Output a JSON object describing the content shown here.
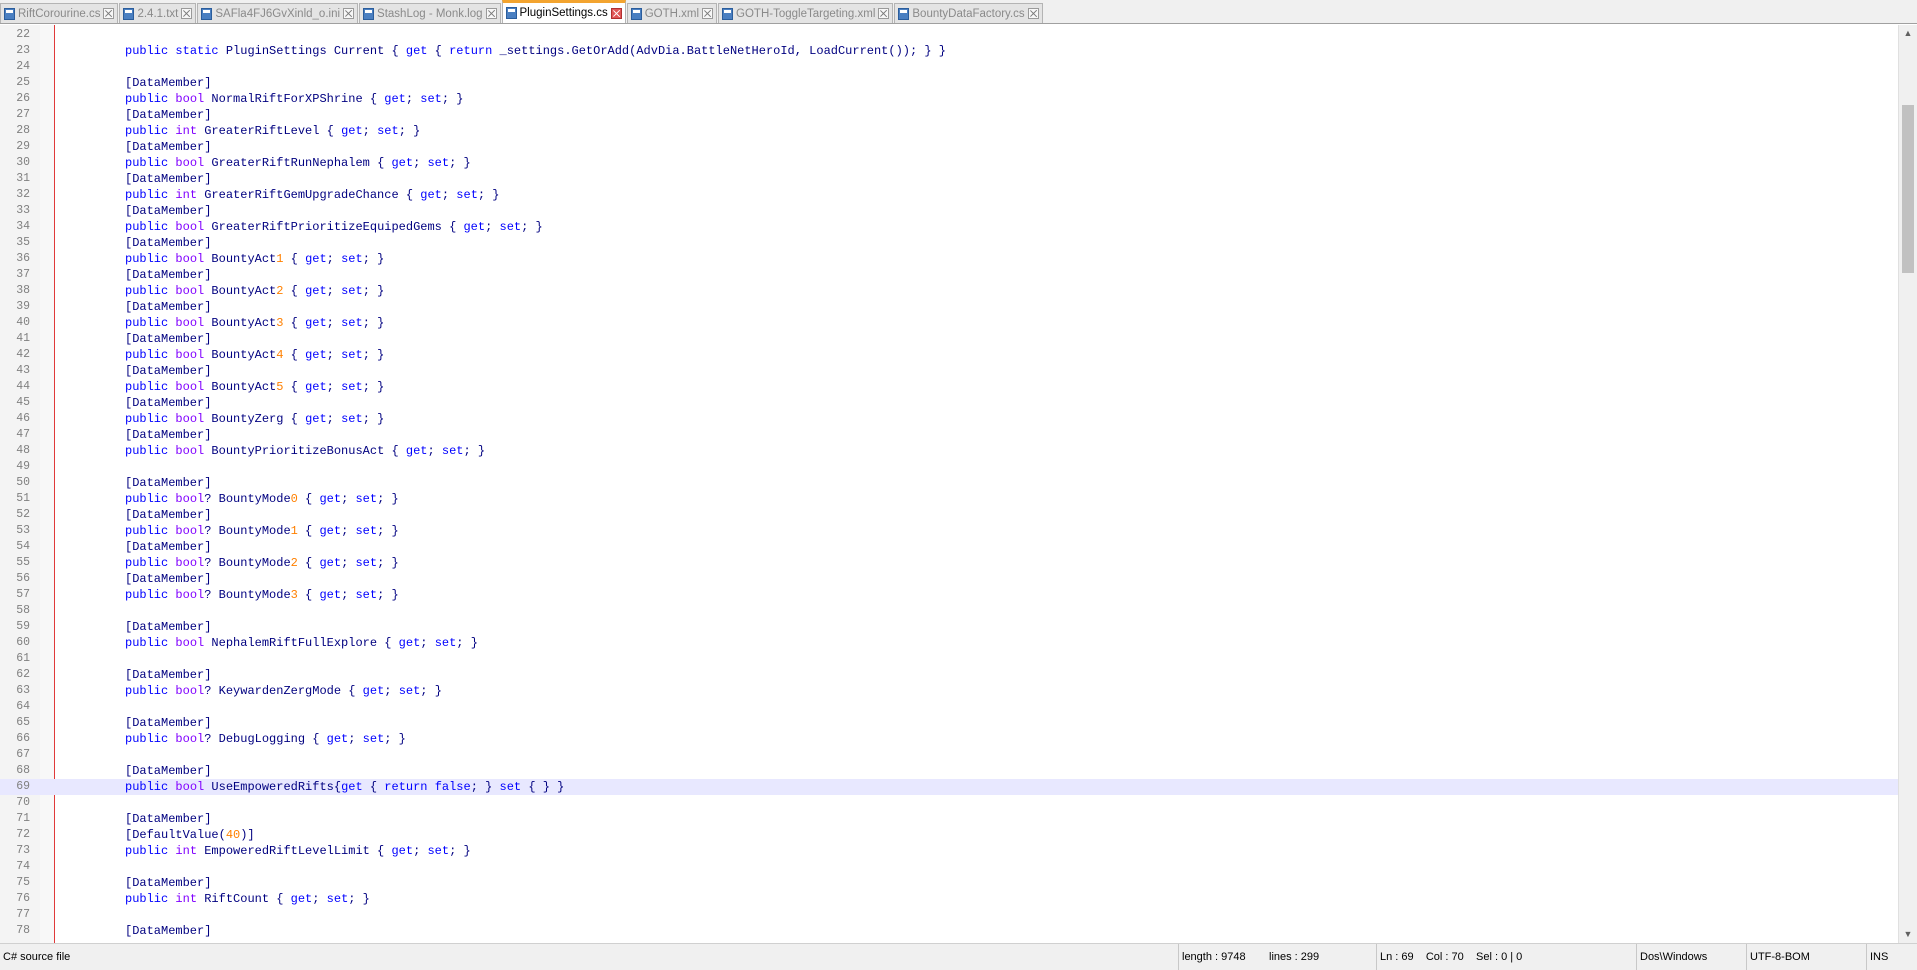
{
  "tabs": [
    {
      "label": "RiftCorourine.cs",
      "active": false
    },
    {
      "label": "2.4.1.txt",
      "active": false
    },
    {
      "label": "SAFla4FJ6GvXinld_o.ini",
      "active": false
    },
    {
      "label": "StashLog - Monk.log",
      "active": false
    },
    {
      "label": "PluginSettings.cs",
      "active": true
    },
    {
      "label": "GOTH.xml",
      "active": false
    },
    {
      "label": "GOTH-ToggleTargeting.xml",
      "active": false
    },
    {
      "label": "BountyDataFactory.cs",
      "active": false
    }
  ],
  "editor": {
    "current_line": 69,
    "lines": [
      {
        "n": "22",
        "code": ""
      },
      {
        "n": "23",
        "code": "public static PluginSettings Current { get { return _settings.GetOrAdd(AdvDia.BattleNetHeroId, LoadCurrent()); } }"
      },
      {
        "n": "24",
        "code": ""
      },
      {
        "n": "25",
        "code": "[DataMember]"
      },
      {
        "n": "26",
        "code": "public bool NormalRiftForXPShrine { get; set; }"
      },
      {
        "n": "27",
        "code": "[DataMember]"
      },
      {
        "n": "28",
        "code": "public int GreaterRiftLevel { get; set; }"
      },
      {
        "n": "29",
        "code": "[DataMember]"
      },
      {
        "n": "30",
        "code": "public bool GreaterRiftRunNephalem { get; set; }"
      },
      {
        "n": "31",
        "code": "[DataMember]"
      },
      {
        "n": "32",
        "code": "public int GreaterRiftGemUpgradeChance { get; set; }"
      },
      {
        "n": "33",
        "code": "[DataMember]"
      },
      {
        "n": "34",
        "code": "public bool GreaterRiftPrioritizeEquipedGems { get; set; }"
      },
      {
        "n": "35",
        "code": "[DataMember]"
      },
      {
        "n": "36",
        "code": "public bool BountyAct1 { get; set; }"
      },
      {
        "n": "37",
        "code": "[DataMember]"
      },
      {
        "n": "38",
        "code": "public bool BountyAct2 { get; set; }"
      },
      {
        "n": "39",
        "code": "[DataMember]"
      },
      {
        "n": "40",
        "code": "public bool BountyAct3 { get; set; }"
      },
      {
        "n": "41",
        "code": "[DataMember]"
      },
      {
        "n": "42",
        "code": "public bool BountyAct4 { get; set; }"
      },
      {
        "n": "43",
        "code": "[DataMember]"
      },
      {
        "n": "44",
        "code": "public bool BountyAct5 { get; set; }"
      },
      {
        "n": "45",
        "code": "[DataMember]"
      },
      {
        "n": "46",
        "code": "public bool BountyZerg { get; set; }"
      },
      {
        "n": "47",
        "code": "[DataMember]"
      },
      {
        "n": "48",
        "code": "public bool BountyPrioritizeBonusAct { get; set; }"
      },
      {
        "n": "49",
        "code": ""
      },
      {
        "n": "50",
        "code": "[DataMember]"
      },
      {
        "n": "51",
        "code": "public bool? BountyMode0 { get; set; }"
      },
      {
        "n": "52",
        "code": "[DataMember]"
      },
      {
        "n": "53",
        "code": "public bool? BountyMode1 { get; set; }"
      },
      {
        "n": "54",
        "code": "[DataMember]"
      },
      {
        "n": "55",
        "code": "public bool? BountyMode2 { get; set; }"
      },
      {
        "n": "56",
        "code": "[DataMember]"
      },
      {
        "n": "57",
        "code": "public bool? BountyMode3 { get; set; }"
      },
      {
        "n": "58",
        "code": ""
      },
      {
        "n": "59",
        "code": "[DataMember]"
      },
      {
        "n": "60",
        "code": "public bool NephalemRiftFullExplore { get; set; }"
      },
      {
        "n": "61",
        "code": ""
      },
      {
        "n": "62",
        "code": "[DataMember]"
      },
      {
        "n": "63",
        "code": "public bool? KeywardenZergMode { get; set; }"
      },
      {
        "n": "64",
        "code": ""
      },
      {
        "n": "65",
        "code": "[DataMember]"
      },
      {
        "n": "66",
        "code": "public bool? DebugLogging { get; set; }"
      },
      {
        "n": "67",
        "code": ""
      },
      {
        "n": "68",
        "code": "[DataMember]"
      },
      {
        "n": "69",
        "code": "public bool UseEmpoweredRifts{get { return false; } set { } }"
      },
      {
        "n": "70",
        "code": ""
      },
      {
        "n": "71",
        "code": "[DataMember]"
      },
      {
        "n": "72",
        "code": "[DefaultValue(40)]"
      },
      {
        "n": "73",
        "code": "public int EmpoweredRiftLevelLimit { get; set; }"
      },
      {
        "n": "74",
        "code": ""
      },
      {
        "n": "75",
        "code": "[DataMember]"
      },
      {
        "n": "76",
        "code": "public int RiftCount { get; set; }"
      },
      {
        "n": "77",
        "code": ""
      },
      {
        "n": "78",
        "code": "[DataMember]"
      }
    ]
  },
  "status": {
    "file_type": "C# source file",
    "length": "length : 9748",
    "lines": "lines : 299",
    "position": "Ln : 69    Col : 70    Sel : 0 | 0",
    "eol": "Dos\\Windows",
    "encoding": "UTF-8-BOM",
    "mode": "INS"
  },
  "colors": {
    "keyword": "#0000ff",
    "type": "#8000ff",
    "identifier": "#000080",
    "number": "#ff8000",
    "active_tab_accent": "#f3a42f",
    "current_line_bg": "#e8e8ff"
  }
}
